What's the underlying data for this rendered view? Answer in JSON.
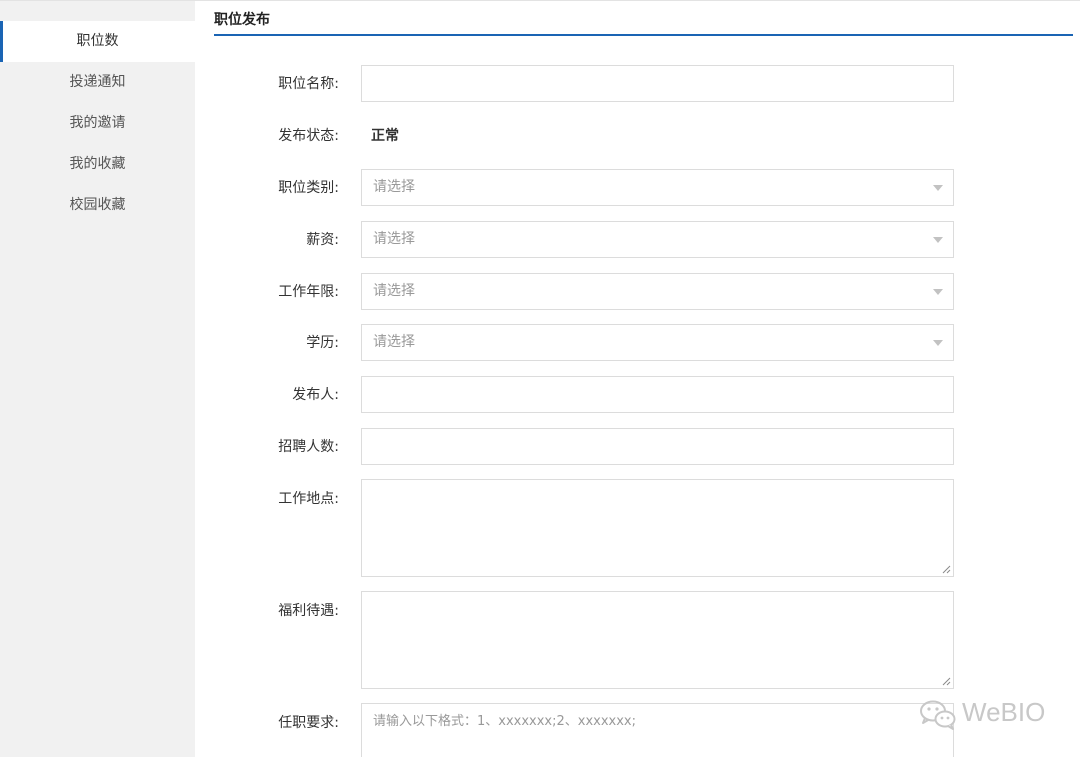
{
  "sidebar": {
    "items": [
      {
        "label": "职位数",
        "active": true
      },
      {
        "label": "投递通知",
        "active": false
      },
      {
        "label": "我的邀请",
        "active": false
      },
      {
        "label": "我的收藏",
        "active": false
      },
      {
        "label": "校园收藏",
        "active": false
      }
    ]
  },
  "header": {
    "title": "职位发布"
  },
  "form": {
    "job_name": {
      "label": "职位名称:",
      "value": ""
    },
    "publish_status": {
      "label": "发布状态:",
      "value": "正常"
    },
    "job_category": {
      "label": "职位类别:",
      "value": "请选择"
    },
    "salary": {
      "label": "薪资:",
      "value": "请选择"
    },
    "work_years": {
      "label": "工作年限:",
      "value": "请选择"
    },
    "education": {
      "label": "学历:",
      "value": "请选择"
    },
    "publisher": {
      "label": "发布人:",
      "value": ""
    },
    "headcount": {
      "label": "招聘人数:",
      "value": ""
    },
    "work_location": {
      "label": "工作地点:",
      "value": ""
    },
    "benefits": {
      "label": "福利待遇:",
      "value": ""
    },
    "requirements": {
      "label": "任职要求:",
      "placeholder": "请输入以下格式：1、xxxxxxx;2、xxxxxxx;"
    }
  },
  "watermark": {
    "icon": "wechat-icon",
    "text": "WeBIO"
  },
  "colors": {
    "accent": "#1a64b4",
    "sidebar_bg": "#f1f1f1",
    "border": "#dcdcdc",
    "placeholder": "#999999"
  }
}
